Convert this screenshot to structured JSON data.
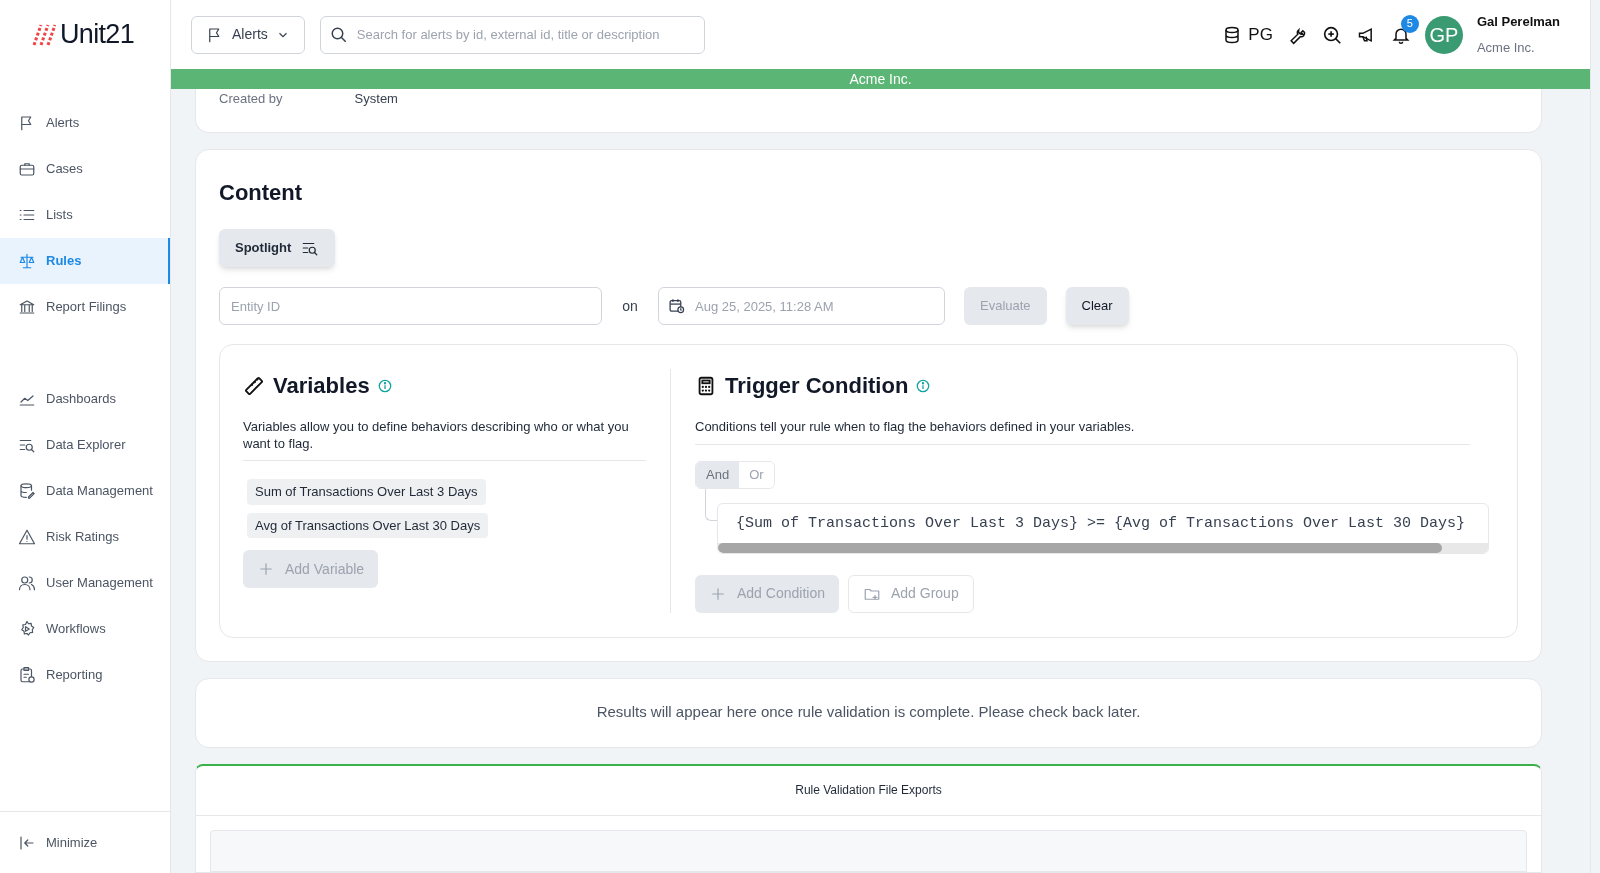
{
  "logo": {
    "text": "Unit21"
  },
  "sidebar": {
    "items": [
      {
        "label": "Alerts",
        "selected": false
      },
      {
        "label": "Cases",
        "selected": false
      },
      {
        "label": "Lists",
        "selected": false
      },
      {
        "label": "Rules",
        "selected": true
      },
      {
        "label": "Report Filings",
        "selected": false
      },
      {
        "label": "Dashboards",
        "selected": false
      },
      {
        "label": "Data Explorer",
        "selected": false
      },
      {
        "label": "Data Management",
        "selected": false
      },
      {
        "label": "Risk Ratings",
        "selected": false
      },
      {
        "label": "User Management",
        "selected": false
      },
      {
        "label": "Workflows",
        "selected": false
      },
      {
        "label": "Reporting",
        "selected": false
      }
    ],
    "minimize": "Minimize"
  },
  "header": {
    "module_button": "Alerts",
    "search": {
      "placeholder": "Search for alerts by id, external id, title or description"
    },
    "database": "PG",
    "notification_count": "5",
    "avatar": "GP",
    "user_name": "Gal Perelman",
    "user_org": "Acme Inc."
  },
  "banner": "Acme Inc.",
  "details": {
    "label": "Created by",
    "value": "System"
  },
  "content": {
    "title": "Content",
    "spotlight_button": "Spotlight",
    "entity_field": {
      "placeholder": "Entity ID"
    },
    "on_label": "on",
    "date_field": {
      "placeholder": "Aug 25, 2025, 11:28 AM"
    },
    "buttons": [
      {
        "label": "Evaluate",
        "disabled": true
      },
      {
        "label": "Clear",
        "disabled": false
      }
    ],
    "variables": {
      "title": "Variables",
      "description": "Variables allow you to define behaviors describing who or what you want to flag.",
      "items": [
        "Sum of Transactions Over Last 3 Days",
        "Avg of Transactions Over Last 30 Days"
      ],
      "add_button": {
        "label": "Add Variable",
        "disabled": true
      }
    },
    "trigger": {
      "title": "Trigger Condition",
      "description": "Conditions tell your rule when to flag the behaviors defined in your variables.",
      "operators": [
        {
          "label": "And",
          "selected": true
        },
        {
          "label": "Or",
          "selected": false
        }
      ],
      "condition": "{Sum of Transactions Over Last 3 Days} >= {Avg of Transactions Over Last 30 Days}",
      "buttons": [
        {
          "label": "Add Condition",
          "kind": "filled",
          "disabled": true
        },
        {
          "label": "Add Group",
          "kind": "outline",
          "disabled": true
        }
      ]
    }
  },
  "results_message": "Results will appear here once rule validation is complete. Please check back later.",
  "exports": {
    "title": "Rule Validation File Exports"
  }
}
